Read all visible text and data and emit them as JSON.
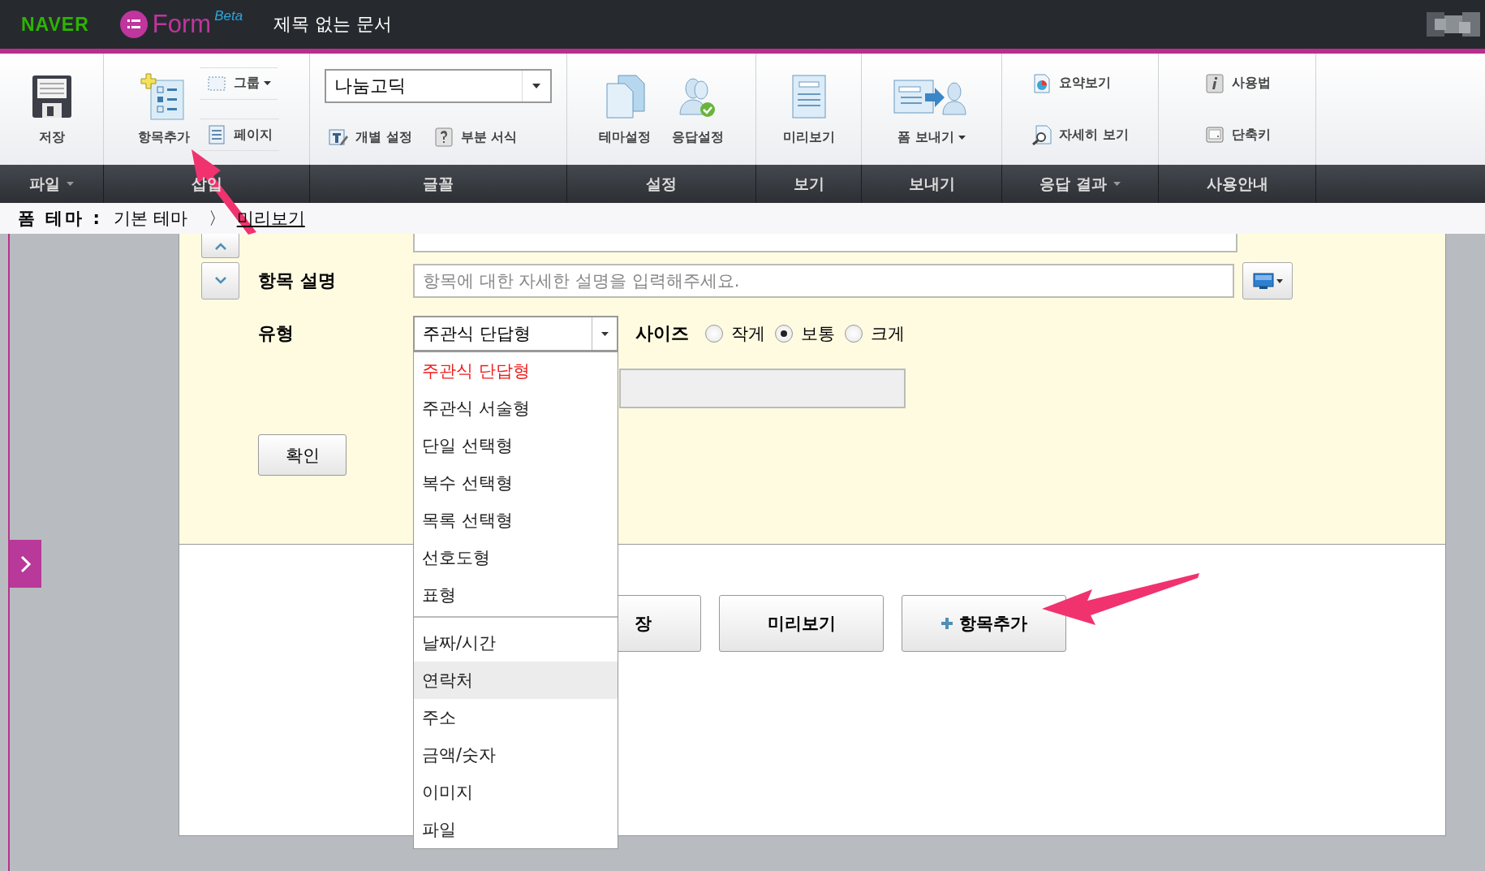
{
  "header": {
    "brand": "NAVER",
    "product": "Form",
    "product_tag": "Beta",
    "document_title": "제목 없는 문서"
  },
  "ribbon": {
    "groups": [
      {
        "label": "파일",
        "caret": true,
        "columns": [
          {
            "rows": [
              [
                {
                  "kind": "large",
                  "label": "저장"
                }
              ]
            ]
          }
        ]
      },
      {
        "label": "삽입",
        "caret": false,
        "columns": [
          {
            "rows": [
              [
                {
                  "kind": "large",
                  "label": "항목추가"
                }
              ]
            ]
          },
          {
            "rows": [
              [
                {
                  "kind": "boxed",
                  "label": "그룹",
                  "caret": true
                }
              ],
              [
                {
                  "kind": "boxed",
                  "label": "페이지"
                }
              ]
            ]
          }
        ]
      },
      {
        "label": "글꼴",
        "caret": false,
        "columns": [
          {
            "rows": [
              [
                {
                  "kind": "select",
                  "label": "나눔고딕"
                }
              ],
              [
                {
                  "kind": "small",
                  "label": "개별 설정"
                },
                {
                  "kind": "small",
                  "label": "부분 서식"
                }
              ]
            ]
          }
        ]
      },
      {
        "label": "설정",
        "caret": false,
        "columns": [
          {
            "rows": [
              [
                {
                  "kind": "large",
                  "label": "테마설정"
                },
                {
                  "kind": "large",
                  "label": "응답설정"
                }
              ]
            ]
          }
        ]
      },
      {
        "label": "보기",
        "caret": false,
        "columns": [
          {
            "rows": [
              [
                {
                  "kind": "large",
                  "label": "미리보기"
                }
              ]
            ]
          }
        ]
      },
      {
        "label": "보내기",
        "caret": false,
        "columns": [
          {
            "rows": [
              [
                {
                  "kind": "large",
                  "label": "폼 보내기",
                  "caret": true
                }
              ]
            ]
          }
        ]
      },
      {
        "label": "응답 결과",
        "caret": true,
        "columns": [
          {
            "rows": [
              [
                {
                  "kind": "small",
                  "label": "요약보기"
                }
              ],
              [
                {
                  "kind": "small",
                  "label": "자세히 보기"
                }
              ]
            ]
          }
        ]
      },
      {
        "label": "사용안내",
        "caret": false,
        "columns": [
          {
            "rows": [
              [
                {
                  "kind": "small",
                  "label": "사용법"
                }
              ],
              [
                {
                  "kind": "small",
                  "label": "단축키"
                }
              ]
            ]
          }
        ]
      }
    ]
  },
  "breadcrumb": {
    "label": "폼 테마 :",
    "theme": "기본 테마",
    "separator": "〉",
    "link": "미리보기"
  },
  "form": {
    "description": {
      "label": "항목 설명",
      "placeholder": "항목에 대한 자세한 설명을 입력해주세요."
    },
    "type": {
      "label": "유형",
      "value": "주관식 단답형",
      "expanded": true,
      "option_groups": [
        [
          {
            "label": "주관식 단답형",
            "selected": true,
            "highlighted": false
          },
          {
            "label": "주관식 서술형",
            "selected": false,
            "highlighted": false
          },
          {
            "label": "단일 선택형",
            "selected": false,
            "highlighted": false
          },
          {
            "label": "복수 선택형",
            "selected": false,
            "highlighted": false
          },
          {
            "label": "목록 선택형",
            "selected": false,
            "highlighted": false
          },
          {
            "label": "선호도형",
            "selected": false,
            "highlighted": false
          },
          {
            "label": "표형",
            "selected": false,
            "highlighted": false
          }
        ],
        [
          {
            "label": "날짜/시간",
            "selected": false,
            "highlighted": false
          },
          {
            "label": "연락처",
            "selected": false,
            "highlighted": true
          },
          {
            "label": "주소",
            "selected": false,
            "highlighted": false
          },
          {
            "label": "금액/숫자",
            "selected": false,
            "highlighted": false
          },
          {
            "label": "이미지",
            "selected": false,
            "highlighted": false
          },
          {
            "label": "파일",
            "selected": false,
            "highlighted": false
          }
        ]
      ]
    },
    "size": {
      "label": "사이즈",
      "options": [
        {
          "label": "작게",
          "selected": false
        },
        {
          "label": "보통",
          "selected": true
        },
        {
          "label": "크게",
          "selected": false
        }
      ]
    },
    "confirm": "확인"
  },
  "buttons": [
    {
      "kind": "partial",
      "label": "장"
    },
    {
      "kind": "plain",
      "label": "미리보기"
    },
    {
      "kind": "add",
      "label": "항목추가"
    }
  ]
}
